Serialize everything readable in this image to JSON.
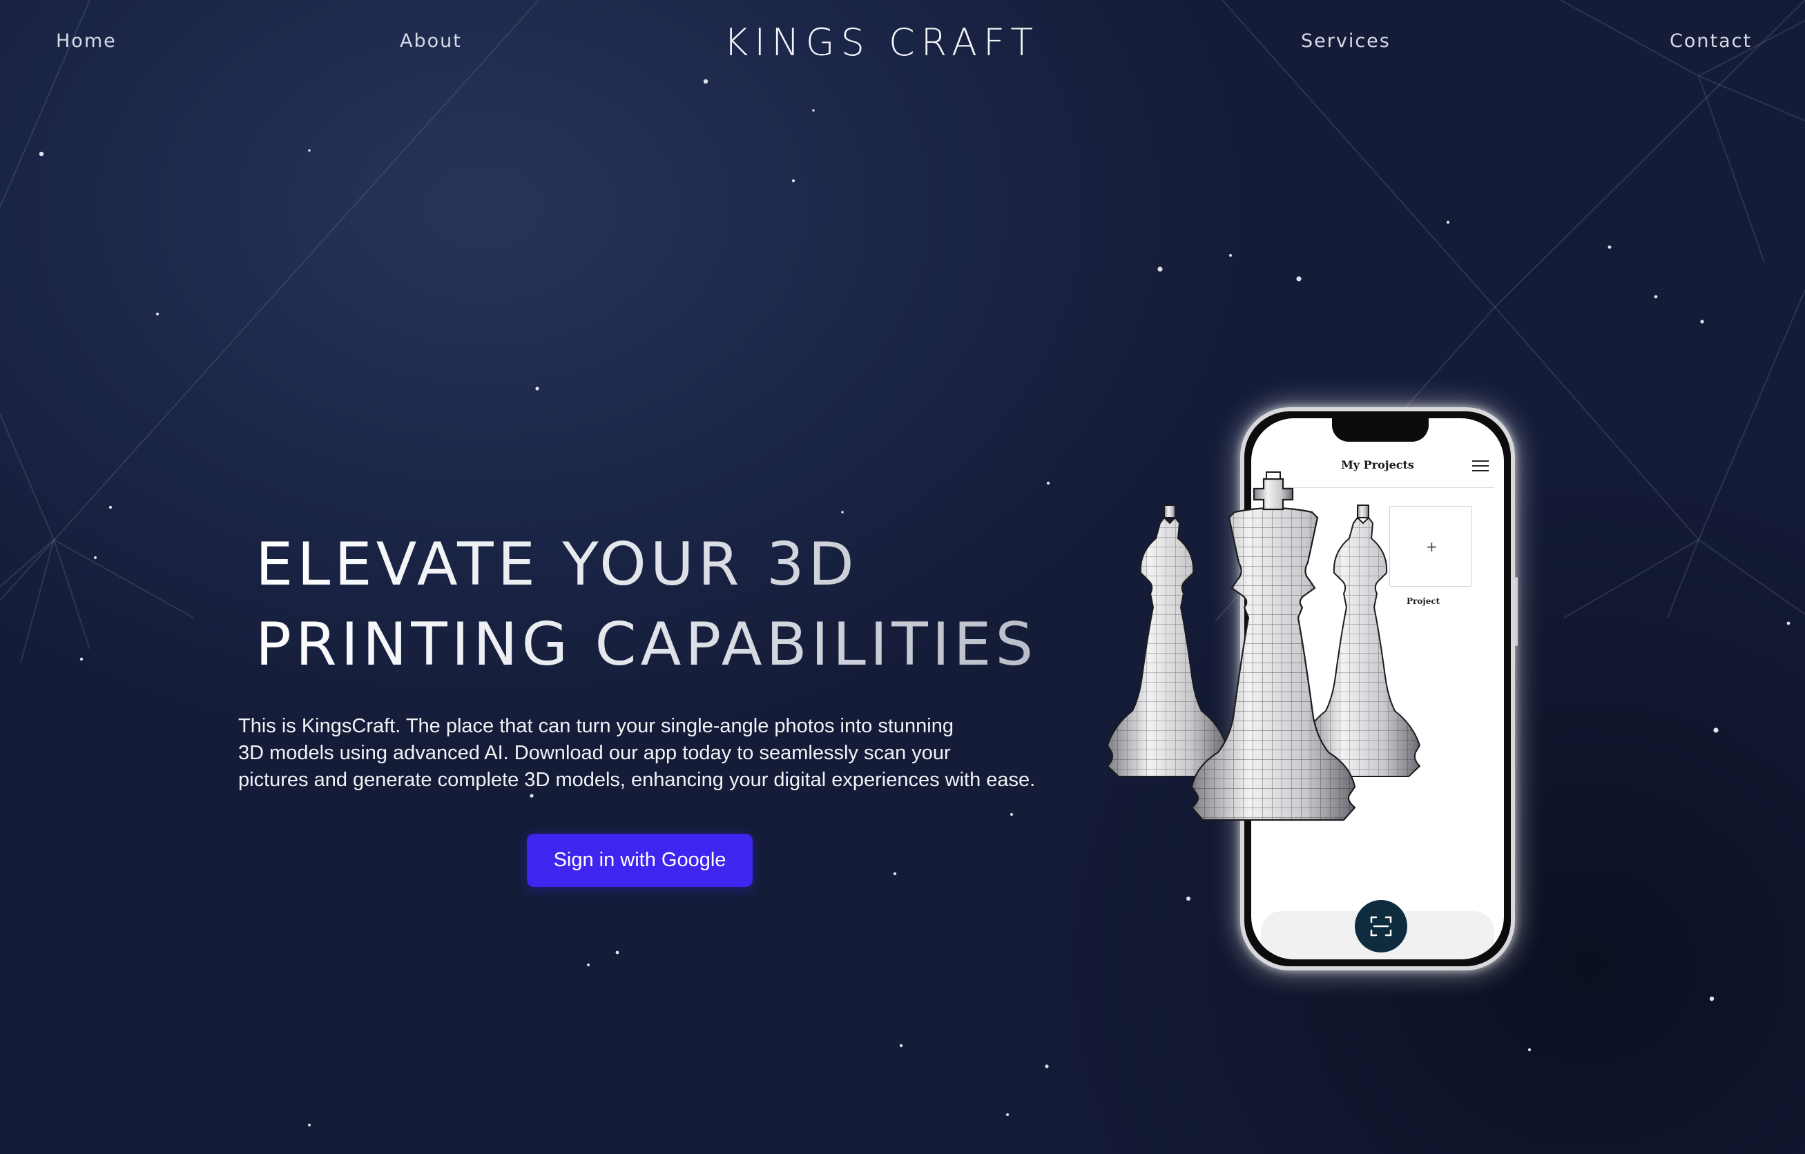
{
  "nav": {
    "home": "Home",
    "about": "About",
    "brand": "KINGS CRAFT",
    "services": "Services",
    "contact": "Contact"
  },
  "hero": {
    "headline_line1": "ELEVATE YOUR 3D",
    "headline_line2": "PRINTING CAPABILITIES",
    "description_line1": "This is KingsCraft. The place that can turn your single-angle photos into stunning",
    "description_line2": "3D models using advanced AI. Download our app today to seamlessly scan your",
    "description_line3": "pictures and generate complete 3D models, enhancing your digital experiences with ease.",
    "cta_label": "Sign in with Google"
  },
  "phone": {
    "screen_title": "My Projects",
    "card_plus": "+",
    "card_label": "Project",
    "icons": [
      "menu-icon",
      "scan-icon"
    ]
  },
  "colors": {
    "background": "#151c38",
    "cta": "#3f25f0",
    "scan_button": "#0f2c3f"
  }
}
